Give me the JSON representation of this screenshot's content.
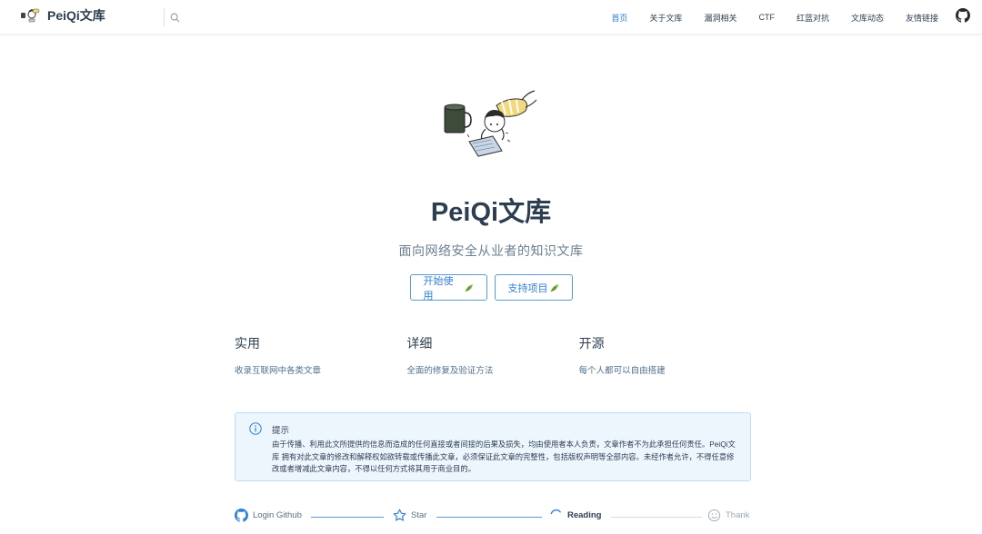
{
  "brand": {
    "name": "PeiQi文库"
  },
  "nav": {
    "items": [
      {
        "label": "首页",
        "active": true
      },
      {
        "label": "关于文库"
      },
      {
        "label": "漏洞相关"
      },
      {
        "label": "CTF"
      },
      {
        "label": "红蓝对抗"
      },
      {
        "label": "文库动态"
      },
      {
        "label": "友情链接"
      }
    ]
  },
  "hero": {
    "title": "PeiQi文库",
    "description": "面向网络安全从业者的知识文库",
    "actions": [
      {
        "label": "开始使用"
      },
      {
        "label": "支持项目"
      }
    ]
  },
  "features": [
    {
      "title": "实用",
      "desc": "收录互联网中各类文章"
    },
    {
      "title": "详细",
      "desc": "全面的修复及验证方法"
    },
    {
      "title": "开源",
      "desc": "每个人都可以自由搭建"
    }
  ],
  "tip": {
    "title": "提示",
    "body": "由于传播、利用此文所提供的信息而造成的任何直接或者间接的后果及损失，均由使用者本人负责，文章作者不为此承担任何责任。PeiQi文库 拥有对此文章的修改和解释权如欲转载或传播此文章，必须保证此文章的完整性，包括版权声明等全部内容。未经作者允许，不得任意修改或者增减此文章内容，不得以任何方式将其用于商业目的。"
  },
  "steps": [
    {
      "label": "Login Github",
      "status": "done"
    },
    {
      "label": "Star",
      "status": "done"
    },
    {
      "label": "Reading",
      "status": "current"
    },
    {
      "label": "Thank",
      "status": "pending"
    }
  ],
  "colors": {
    "accent": "#2f7fd8",
    "text": "#2c3e50",
    "tip_bg": "#eef6fd"
  }
}
